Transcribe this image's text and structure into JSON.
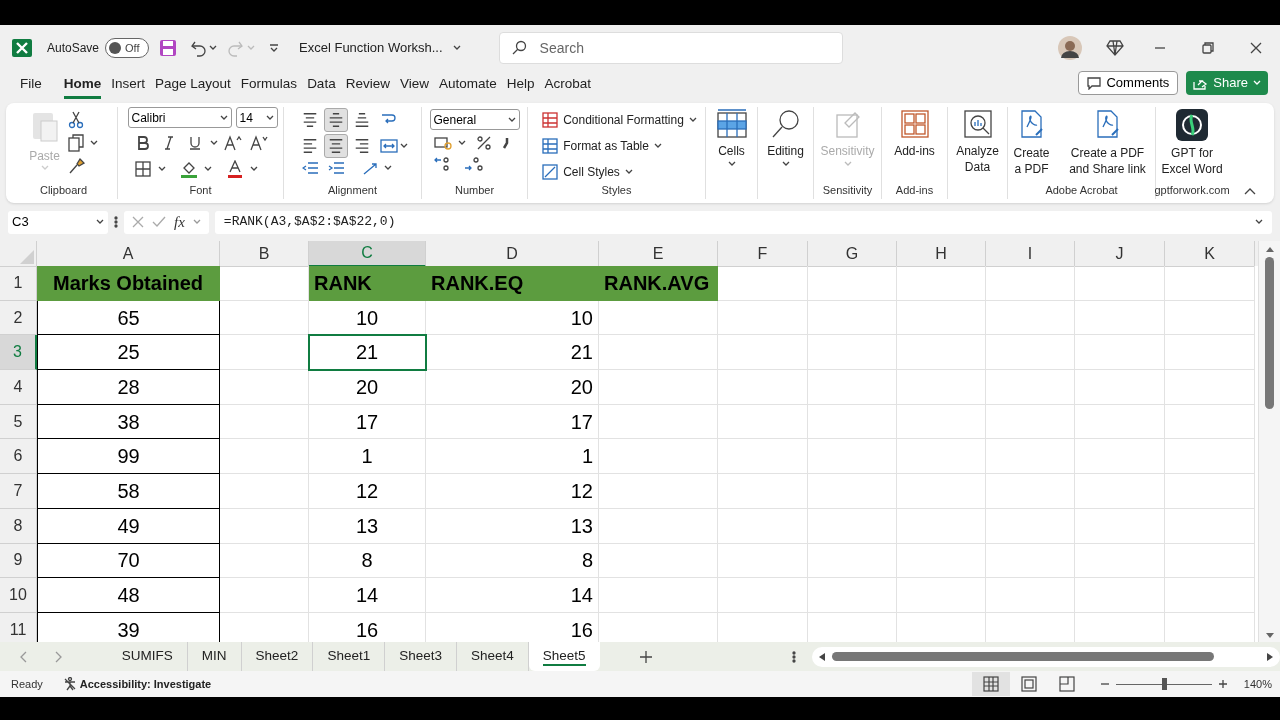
{
  "title_bar": {
    "autosave_label": "AutoSave",
    "autosave": {
      "on": false,
      "label": "Off"
    },
    "document_title": "Excel Function Worksh...",
    "search_placeholder": "Search"
  },
  "menu_tabs": [
    {
      "label": "File",
      "selected": false
    },
    {
      "label": "Home",
      "selected": true
    },
    {
      "label": "Insert",
      "selected": false
    },
    {
      "label": "Page Layout",
      "selected": false
    },
    {
      "label": "Formulas",
      "selected": false
    },
    {
      "label": "Data",
      "selected": false
    },
    {
      "label": "Review",
      "selected": false
    },
    {
      "label": "View",
      "selected": false
    },
    {
      "label": "Automate",
      "selected": false
    },
    {
      "label": "Help",
      "selected": false
    },
    {
      "label": "Acrobat",
      "selected": false
    }
  ],
  "comments_button": "Comments",
  "share_button": "Share",
  "ribbon": {
    "groups": [
      {
        "kind": "clipboard",
        "label": "Clipboard",
        "paste": "Paste",
        "paste_disabled": true
      },
      {
        "kind": "font",
        "label": "Font",
        "font_name": "Calibri",
        "font_size": "14"
      },
      {
        "kind": "alignment",
        "label": "Alignment",
        "buttons": [
          {
            "kind": "top",
            "selected": false
          },
          {
            "kind": "middle",
            "selected": true
          },
          {
            "kind": "bottom",
            "selected": false
          },
          {
            "kind": "left",
            "selected": false
          },
          {
            "kind": "center",
            "selected": true
          },
          {
            "kind": "right",
            "selected": false
          }
        ]
      },
      {
        "kind": "number",
        "label": "Number",
        "format": "General"
      },
      {
        "kind": "styles",
        "label": "Styles",
        "items": [
          "Conditional Formatting",
          "Format as Table",
          "Cell Styles"
        ]
      },
      {
        "kind": "cells",
        "button": "Cells"
      },
      {
        "kind": "editing",
        "button": "Editing"
      },
      {
        "kind": "sensitivity",
        "button": "Sensitivity",
        "label": "Sensitivity",
        "disabled": true
      },
      {
        "kind": "addins",
        "button": "Add-ins",
        "label": "Add-ins"
      },
      {
        "kind": "analyze",
        "button": "Analyze Data"
      },
      {
        "kind": "acrobat",
        "label": "Adobe Acrobat",
        "buttons": [
          "Create a PDF",
          "Create a PDF and Share link"
        ]
      },
      {
        "kind": "gpt",
        "button": "GPT for Excel Word",
        "label": "gptforwork.com"
      }
    ]
  },
  "formula_bar": {
    "name_box": "C3",
    "function_label": "fx",
    "formula": "=RANK(A3,$A$2:$A$22,0)"
  },
  "sheet": {
    "columns": [
      {
        "label": "A",
        "selected": false,
        "bordered": true
      },
      {
        "label": "B",
        "selected": false,
        "bordered": false
      },
      {
        "label": "C",
        "selected": true,
        "bordered": false
      },
      {
        "label": "D",
        "selected": false,
        "bordered": false
      },
      {
        "label": "E",
        "selected": false,
        "bordered": false
      },
      {
        "label": "F",
        "selected": false,
        "bordered": false
      },
      {
        "label": "G",
        "selected": false,
        "bordered": false
      },
      {
        "label": "H",
        "selected": false,
        "bordered": false
      },
      {
        "label": "I",
        "selected": false,
        "bordered": false
      },
      {
        "label": "J",
        "selected": false,
        "bordered": false
      },
      {
        "label": "K",
        "selected": false,
        "bordered": false
      }
    ],
    "rows": [
      {
        "label": "1",
        "selected": false,
        "kind": "header",
        "cells": {
          "A": "Marks Obtained",
          "C": "RANK",
          "D": "RANK.EQ",
          "E": "RANK.AVG"
        }
      },
      {
        "label": "2",
        "selected": false,
        "kind": "data",
        "cells": {
          "A": "65",
          "C": "10",
          "D": "10"
        }
      },
      {
        "label": "3",
        "selected": true,
        "kind": "data",
        "cells": {
          "A": "25",
          "C": "21",
          "D": "21"
        }
      },
      {
        "label": "4",
        "selected": false,
        "kind": "data",
        "cells": {
          "A": "28",
          "C": "20",
          "D": "20"
        }
      },
      {
        "label": "5",
        "selected": false,
        "kind": "data",
        "cells": {
          "A": "38",
          "C": "17",
          "D": "17"
        }
      },
      {
        "label": "6",
        "selected": false,
        "kind": "data",
        "cells": {
          "A": "99",
          "C": "1",
          "D": "1"
        }
      },
      {
        "label": "7",
        "selected": false,
        "kind": "data",
        "cells": {
          "A": "58",
          "C": "12",
          "D": "12"
        }
      },
      {
        "label": "8",
        "selected": false,
        "kind": "data",
        "cells": {
          "A": "49",
          "C": "13",
          "D": "13"
        }
      },
      {
        "label": "9",
        "selected": false,
        "kind": "data",
        "cells": {
          "A": "70",
          "C": "8",
          "D": "8"
        }
      },
      {
        "label": "10",
        "selected": false,
        "kind": "data",
        "cells": {
          "A": "48",
          "C": "14",
          "D": "14"
        }
      },
      {
        "label": "11",
        "selected": false,
        "kind": "data",
        "cells": {
          "A": "39",
          "C": "16",
          "D": "16"
        }
      }
    ]
  },
  "sheet_tabs": [
    {
      "label": "SUMIFS",
      "selected": false
    },
    {
      "label": "MIN",
      "selected": false
    },
    {
      "label": "Sheet2",
      "selected": false
    },
    {
      "label": "Sheet1",
      "selected": false
    },
    {
      "label": "Sheet3",
      "selected": false
    },
    {
      "label": "Sheet4",
      "selected": false
    },
    {
      "label": "Sheet5",
      "selected": true
    }
  ],
  "status_bar": {
    "ready": "Ready",
    "accessibility": "Accessibility: Investigate",
    "views": [
      {
        "kind": "normal",
        "selected": true
      },
      {
        "kind": "page_layout",
        "selected": false
      },
      {
        "kind": "page_break",
        "selected": false
      }
    ],
    "zoom": {
      "level": 0.5,
      "label": "140%"
    }
  }
}
